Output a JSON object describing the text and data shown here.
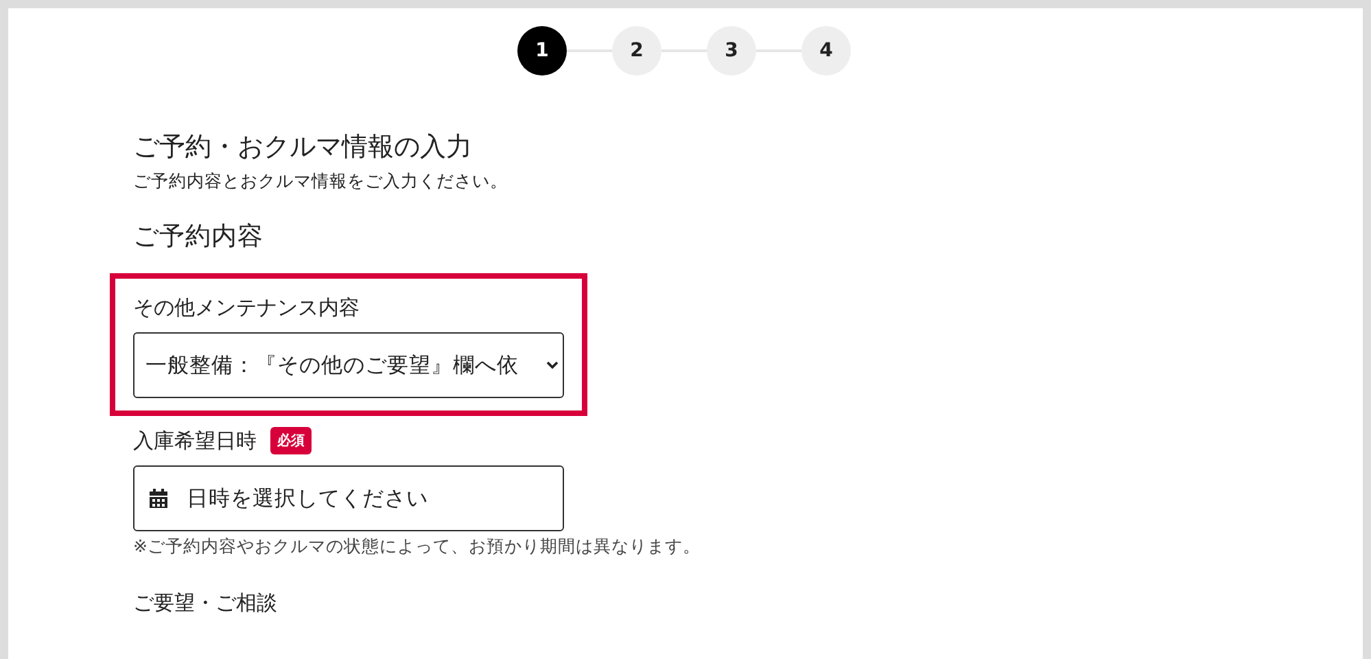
{
  "steps": [
    {
      "label": "1",
      "selected": true
    },
    {
      "label": "2",
      "selected": false
    },
    {
      "label": "3",
      "selected": false
    },
    {
      "label": "4",
      "selected": false
    }
  ],
  "title": "ご予約・おクルマ情報の入力",
  "subtitle": "ご予約内容とおクルマ情報をご入力ください。",
  "section_heading": "ご予約内容",
  "fields": [
    {
      "kind": "select",
      "label": "その他メンテナンス内容",
      "value": "一般整備：『その他のご要望』欄へ依",
      "highlighted": true
    },
    {
      "kind": "date",
      "label": "入庫希望日時",
      "badge": "必須",
      "placeholder": "日時を選択してください",
      "note": "※ご予約内容やおクルマの状態によって、お預かり期間は異なります。",
      "highlighted": false
    },
    {
      "kind": "heading",
      "label": "ご要望・ご相談",
      "highlighted": false
    }
  ]
}
